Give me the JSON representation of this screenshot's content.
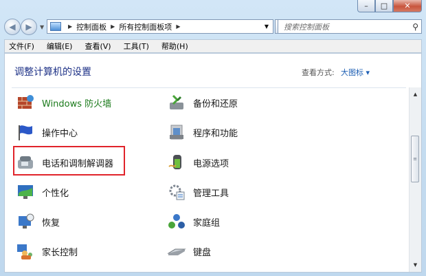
{
  "window": {
    "controls": {
      "minimize": "–",
      "maximize": "□",
      "close": "✕"
    }
  },
  "nav": {
    "back_icon": "back-arrow",
    "forward_icon": "forward-arrow",
    "breadcrumb": [
      "控制面板",
      "所有控制面板项"
    ],
    "search_placeholder": "搜索控制面板"
  },
  "menu": [
    "文件(F)",
    "编辑(E)",
    "查看(V)",
    "工具(T)",
    "帮助(H)"
  ],
  "content": {
    "heading": "调整计算机的设置",
    "view_by_label": "查看方式:",
    "view_by_value": "大图标 ▾",
    "left_items": [
      "Windows 防火墙",
      "操作中心",
      "电话和调制解调器",
      "个性化",
      "恢复",
      "家长控制"
    ],
    "right_items": [
      "备份和还原",
      "程序和功能",
      "电源选项",
      "管理工具",
      "家庭组",
      "键盘"
    ],
    "highlighted_item": "电话和调制解调器"
  },
  "colors": {
    "heading": "#1e3287",
    "link": "#1e5fb4",
    "highlight": "#e0232a"
  }
}
